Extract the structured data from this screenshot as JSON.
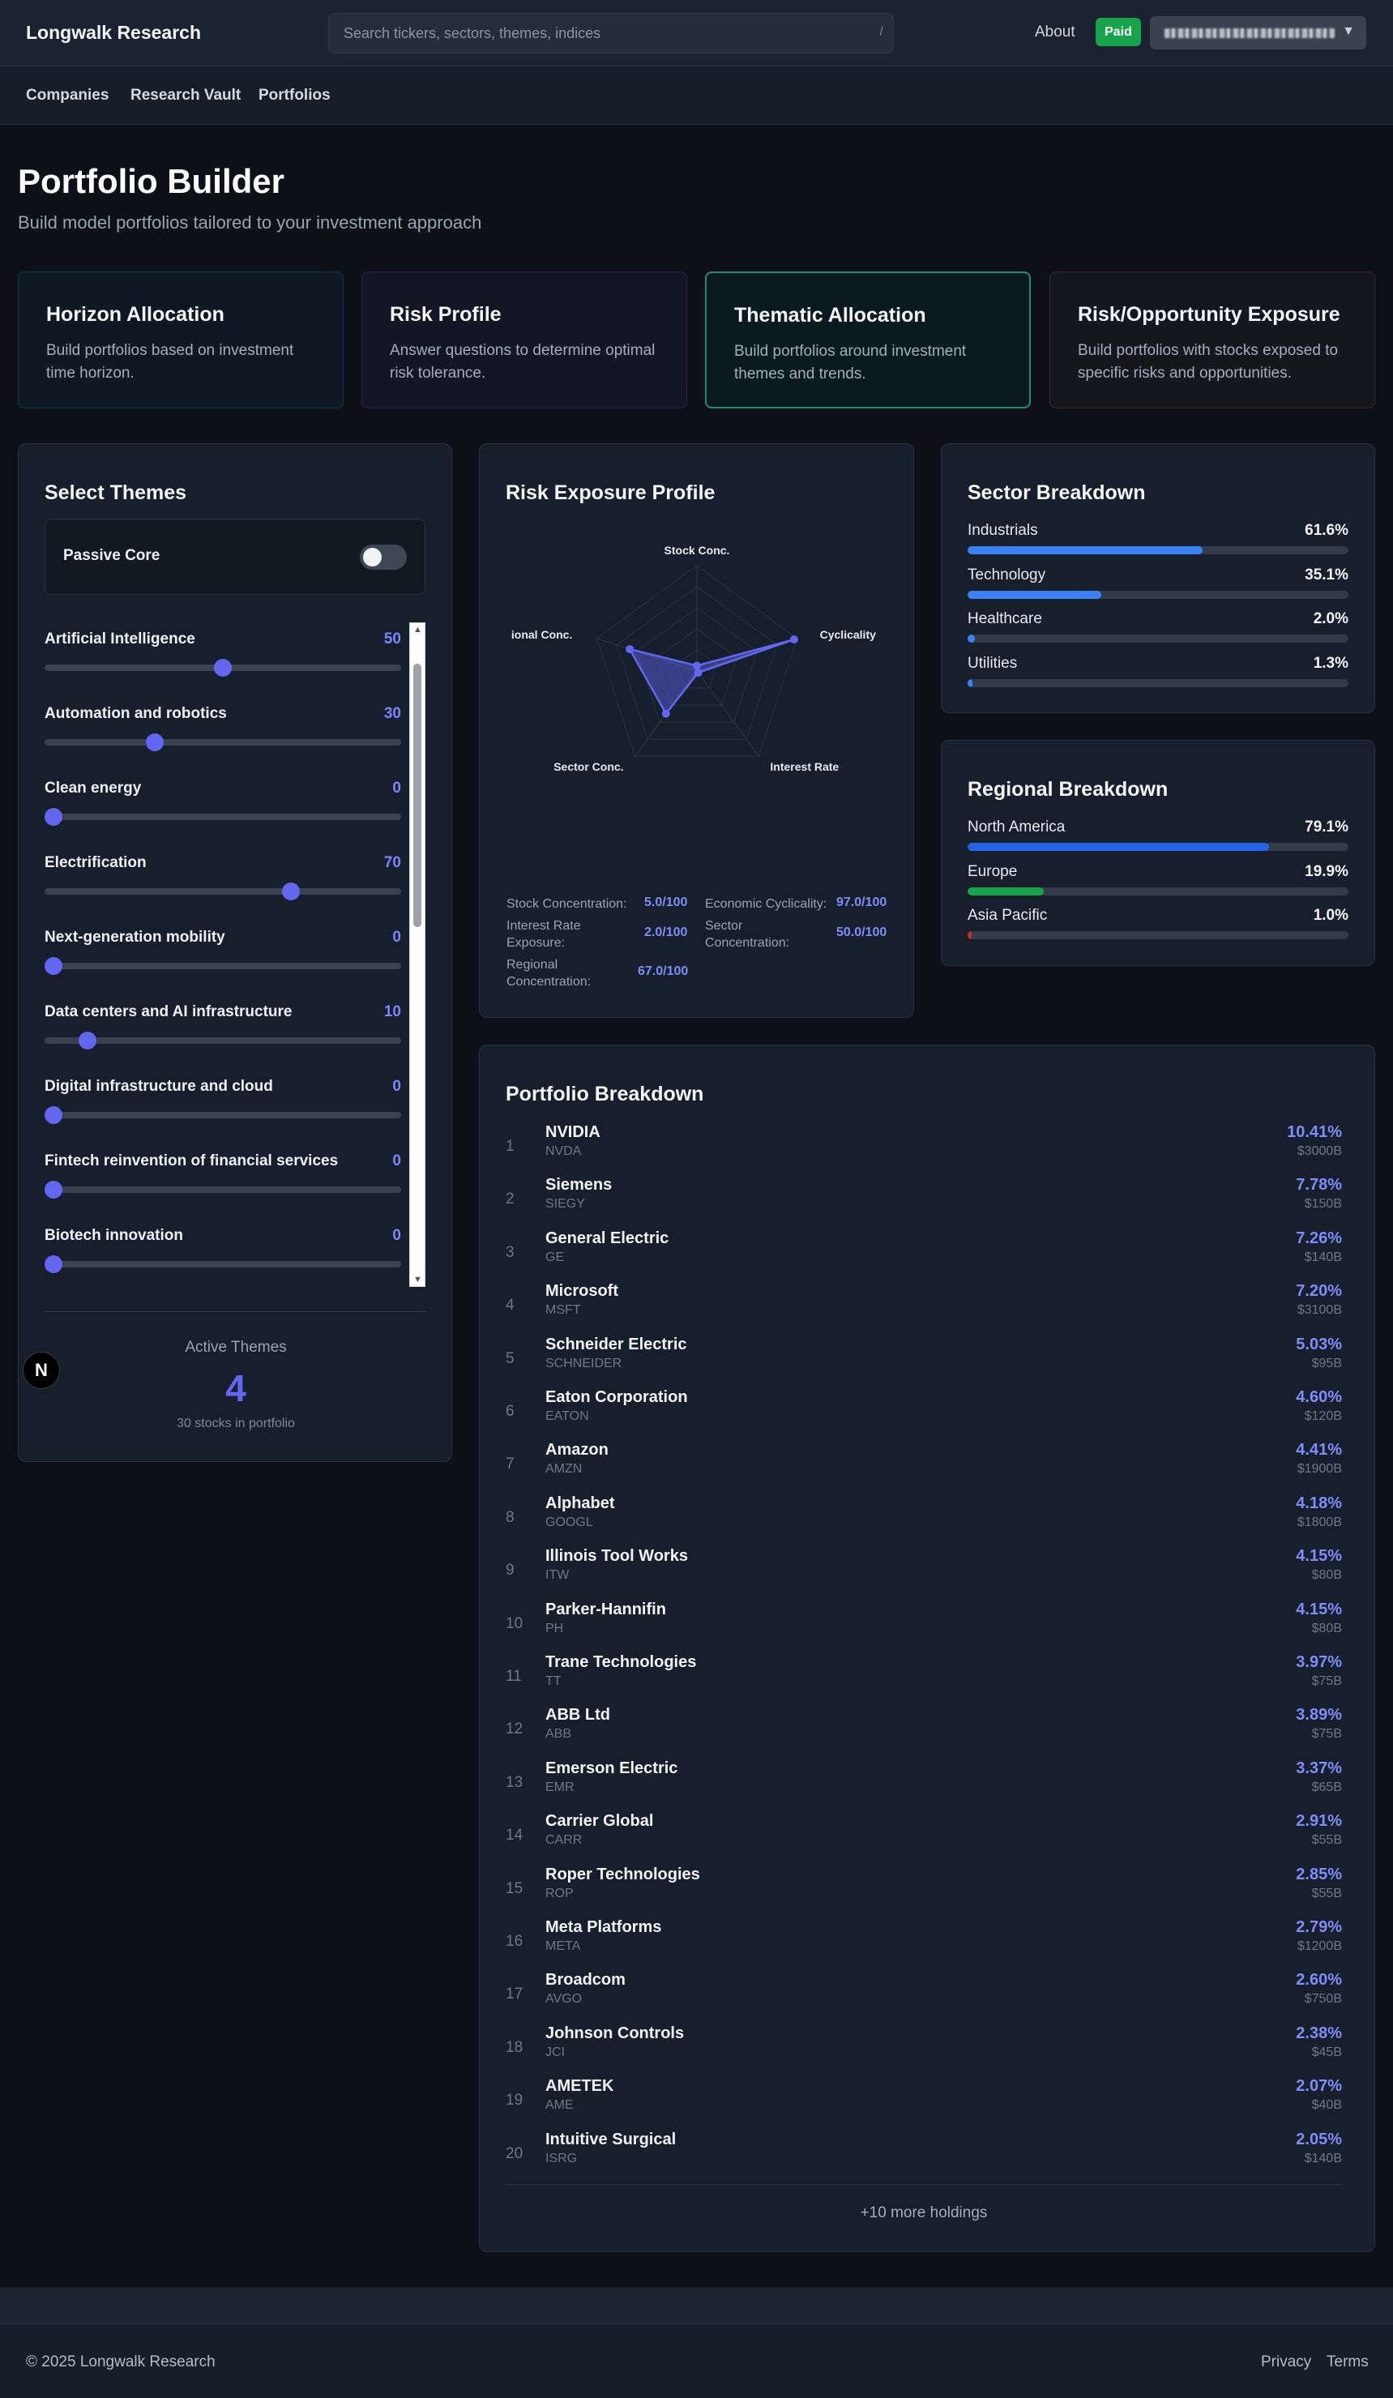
{
  "header": {
    "brand": "Longwalk Research",
    "search_placeholder": "Search tickers, sectors, themes, indices",
    "search_shortcut": "/",
    "about": "About",
    "plan_badge": "Paid"
  },
  "nav": {
    "items": [
      "Companies",
      "Research Vault",
      "Portfolios"
    ]
  },
  "page": {
    "title": "Portfolio Builder",
    "subtitle": "Build model portfolios tailored to your investment approach"
  },
  "modes": [
    {
      "title": "Horizon Allocation",
      "desc": "Build portfolios based on investment time horizon.",
      "accent": "#0e3a48",
      "bg": "#0f1923",
      "selected": false
    },
    {
      "title": "Risk Profile",
      "desc": "Answer questions to determine optimal risk tolerance.",
      "accent": "#33204f",
      "bg": "#141525",
      "selected": false
    },
    {
      "title": "Thematic Allocation",
      "desc": "Build portfolios around investment themes and trends.",
      "accent": "#1f8f6a",
      "bg": "#0b1a1f",
      "selected": true
    },
    {
      "title": "Risk/Opportunity Exposure",
      "desc": "Build portfolios with stocks exposed to specific risks and opportunities.",
      "accent": "#3b2a1c",
      "bg": "#15171c",
      "selected": false
    }
  ],
  "themes_panel": {
    "title": "Select Themes",
    "passive_core_label": "Passive Core",
    "passive_core_on": false,
    "themes": [
      {
        "name": "Artificial Intelligence",
        "value": 50
      },
      {
        "name": "Automation and robotics",
        "value": 30
      },
      {
        "name": "Clean energy",
        "value": 0
      },
      {
        "name": "Electrification",
        "value": 70
      },
      {
        "name": "Next-generation mobility",
        "value": 0
      },
      {
        "name": "Data centers and AI infrastructure",
        "value": 10
      },
      {
        "name": "Digital infrastructure and cloud",
        "value": 0
      },
      {
        "name": "Fintech reinvention of financial services",
        "value": 0
      },
      {
        "name": "Biotech innovation",
        "value": 0
      }
    ],
    "slider_max": 100,
    "active_label": "Active Themes",
    "active_count": "4",
    "stocks_note": "30 stocks in portfolio"
  },
  "risk_panel": {
    "title": "Risk Exposure Profile",
    "radar_labels": [
      "Stock Conc.",
      "Cyclicality",
      "Interest Rate",
      "Sector Conc.",
      "ional Conc."
    ],
    "radar_values": [
      5.0,
      97.0,
      2.0,
      50.0,
      67.0
    ],
    "radar_max": 100,
    "radar_color": "#6366f1",
    "metrics": [
      {
        "label": "Stock Concentration:",
        "value": "5.0/100"
      },
      {
        "label": "Economic Cyclicality:",
        "value": "97.0/100"
      },
      {
        "label": "Interest Rate Exposure:",
        "value": "2.0/100"
      },
      {
        "label": "Sector Concentration:",
        "value": "50.0/100"
      },
      {
        "label": "Regional Concentration:",
        "value": "67.0/100"
      }
    ]
  },
  "sector_panel": {
    "title": "Sector Breakdown",
    "rows": [
      {
        "name": "Industrials",
        "pct": "61.6%",
        "value": 61.6,
        "color": "#3b82f6"
      },
      {
        "name": "Technology",
        "pct": "35.1%",
        "value": 35.1,
        "color": "#3b82f6"
      },
      {
        "name": "Healthcare",
        "pct": "2.0%",
        "value": 2.0,
        "color": "#3b82f6"
      },
      {
        "name": "Utilities",
        "pct": "1.3%",
        "value": 1.3,
        "color": "#3b82f6"
      }
    ]
  },
  "region_panel": {
    "title": "Regional Breakdown",
    "rows": [
      {
        "name": "North America",
        "pct": "79.1%",
        "value": 79.1,
        "color": "#2563eb"
      },
      {
        "name": "Europe",
        "pct": "19.9%",
        "value": 19.9,
        "color": "#16a34a"
      },
      {
        "name": "Asia Pacific",
        "pct": "1.0%",
        "value": 1.0,
        "color": "#dc2626"
      }
    ]
  },
  "portfolio_panel": {
    "title": "Portfolio Breakdown",
    "holdings": [
      {
        "rank": "1",
        "name": "NVIDIA",
        "ticker": "NVDA",
        "weight": "10.41%",
        "cap": "$3000B"
      },
      {
        "rank": "2",
        "name": "Siemens",
        "ticker": "SIEGY",
        "weight": "7.78%",
        "cap": "$150B"
      },
      {
        "rank": "3",
        "name": "General Electric",
        "ticker": "GE",
        "weight": "7.26%",
        "cap": "$140B"
      },
      {
        "rank": "4",
        "name": "Microsoft",
        "ticker": "MSFT",
        "weight": "7.20%",
        "cap": "$3100B"
      },
      {
        "rank": "5",
        "name": "Schneider Electric",
        "ticker": "SCHNEIDER",
        "weight": "5.03%",
        "cap": "$95B"
      },
      {
        "rank": "6",
        "name": "Eaton Corporation",
        "ticker": "EATON",
        "weight": "4.60%",
        "cap": "$120B"
      },
      {
        "rank": "7",
        "name": "Amazon",
        "ticker": "AMZN",
        "weight": "4.41%",
        "cap": "$1900B"
      },
      {
        "rank": "8",
        "name": "Alphabet",
        "ticker": "GOOGL",
        "weight": "4.18%",
        "cap": "$1800B"
      },
      {
        "rank": "9",
        "name": "Illinois Tool Works",
        "ticker": "ITW",
        "weight": "4.15%",
        "cap": "$80B"
      },
      {
        "rank": "10",
        "name": "Parker-Hannifin",
        "ticker": "PH",
        "weight": "4.15%",
        "cap": "$80B"
      },
      {
        "rank": "11",
        "name": "Trane Technologies",
        "ticker": "TT",
        "weight": "3.97%",
        "cap": "$75B"
      },
      {
        "rank": "12",
        "name": "ABB Ltd",
        "ticker": "ABB",
        "weight": "3.89%",
        "cap": "$75B"
      },
      {
        "rank": "13",
        "name": "Emerson Electric",
        "ticker": "EMR",
        "weight": "3.37%",
        "cap": "$65B"
      },
      {
        "rank": "14",
        "name": "Carrier Global",
        "ticker": "CARR",
        "weight": "2.91%",
        "cap": "$55B"
      },
      {
        "rank": "15",
        "name": "Roper Technologies",
        "ticker": "ROP",
        "weight": "2.85%",
        "cap": "$55B"
      },
      {
        "rank": "16",
        "name": "Meta Platforms",
        "ticker": "META",
        "weight": "2.79%",
        "cap": "$1200B"
      },
      {
        "rank": "17",
        "name": "Broadcom",
        "ticker": "AVGO",
        "weight": "2.60%",
        "cap": "$750B"
      },
      {
        "rank": "18",
        "name": "Johnson Controls",
        "ticker": "JCI",
        "weight": "2.38%",
        "cap": "$45B"
      },
      {
        "rank": "19",
        "name": "AMETEK",
        "ticker": "AME",
        "weight": "2.07%",
        "cap": "$40B"
      },
      {
        "rank": "20",
        "name": "Intuitive Surgical",
        "ticker": "ISRG",
        "weight": "2.05%",
        "cap": "$140B"
      }
    ],
    "more": "+10 more holdings"
  },
  "dev_badge": "N",
  "footer": {
    "copyright": "© 2025 Longwalk Research",
    "privacy": "Privacy",
    "terms": "Terms"
  }
}
